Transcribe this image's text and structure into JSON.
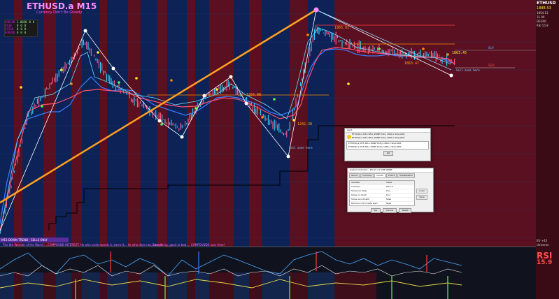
{
  "header": {
    "title": "ETHUSD.a M15",
    "subtitle": "Currency Don't Be Greedy"
  },
  "stats_table": [
    {
      "sym": "USDCAD",
      "v1": "1.0030",
      "v2": "0",
      "v3": "0"
    },
    {
      "sym": "US30",
      "v1": "0",
      "v2": "0",
      "v3": "0"
    },
    {
      "sym": "DJI30",
      "v1": "0",
      "v2": "0",
      "v3": "0"
    },
    {
      "sym": "EURUSD",
      "v1": "0",
      "v2": "0",
      "v3": "0"
    }
  ],
  "price_labels": {
    "top_right": "1965.01",
    "left_mid": "1256.88",
    "low": "1242.38",
    "zone_label": "Sell zone here",
    "bottom_zone": "Sell zone here",
    "mid_right": "1863.45",
    "mid_right2": "1863.47",
    "buy": "BUY",
    "sell": "SELL"
  },
  "right_panel": {
    "symbol": "ETHUSD",
    "price": "1888.53",
    "lines": [
      "1854.13",
      "31.90",
      "DEU40",
      "RSI 15.9"
    ],
    "rsi_label": "RSI",
    "rsi_value": "15.9",
    "footer1": "EU +45",
    "footer2": "Universe"
  },
  "trend_banner": "M15 DOWN TREND - SELLS ONLY",
  "bottom_caption": "The 8th Wonder of the World ... COMPOUND INTEREST. He who understands it, earns it... he who does not, pays it.",
  "bottom_caption2": "Everything, good or bad.... COMPOUNDS over time!",
  "dialog1": {
    "title": "Alert",
    "items": [
      "ETHUSD.a M15 SELL ZONE Entry 1864.x  Stop1891",
      "ETHUSD.a M15 SELL ZONE Entry 1864.x  Stop1891",
      "ETHUSD.a M15 SELL ZONE Entry 1864.x  Stop1891",
      "ETHUSD.a M15 SELL ZONE Entry 1864.x  Stop1891"
    ],
    "ok": "OK"
  },
  "dialog2": {
    "title": "Custom Indicator - RSI 15 v4 SIDE ZONE",
    "tabs": [
      "About",
      "Common",
      "Inputs",
      "Colors",
      "Visualization"
    ],
    "columns": [
      "Variable",
      "Value"
    ],
    "rows": [
      {
        "var": "Indicator",
        "val": "RSI 15"
      },
      {
        "var": "Show bar label",
        "val": "true"
      },
      {
        "var": "Show on chart",
        "val": "true"
      },
      {
        "var": "Show as indicator",
        "val": "false"
      },
      {
        "var": "Remove out-of-date alert",
        "val": "false"
      }
    ],
    "side_buttons": [
      "Load",
      "Save"
    ],
    "ok": "OK",
    "cancel": "Cancel",
    "reset": "Reset"
  }
}
